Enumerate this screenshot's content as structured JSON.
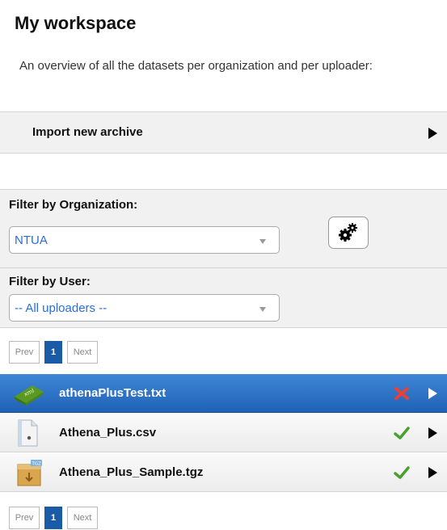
{
  "page": {
    "title": "My workspace",
    "description": "An overview of all the datasets per organization and per uploader:"
  },
  "import": {
    "label": "Import new archive"
  },
  "filters": {
    "organization": {
      "label": "Filter by Organization:",
      "selected": "NTUA"
    },
    "user": {
      "label": "Filter by User:",
      "selected": "-- All uploaders --"
    },
    "settings_icon": "gears-icon"
  },
  "pagination": {
    "prev": "Prev",
    "page": "1",
    "next": "Next"
  },
  "files": [
    {
      "name": "athenaPlusTest.txt",
      "icon": "xml-file-icon",
      "status": "error",
      "selected": true
    },
    {
      "name": "Athena_Plus.csv",
      "icon": "csv-file-icon",
      "status": "ok",
      "selected": false
    },
    {
      "name": "Athena_Plus_Sample.tgz",
      "icon": "archive-file-icon",
      "status": "ok",
      "selected": false
    }
  ],
  "colors": {
    "selected_row": "#2b70c4",
    "link_blue": "#2a6fd6",
    "error_red": "#e8413c",
    "ok_green": "#4aa02c"
  }
}
